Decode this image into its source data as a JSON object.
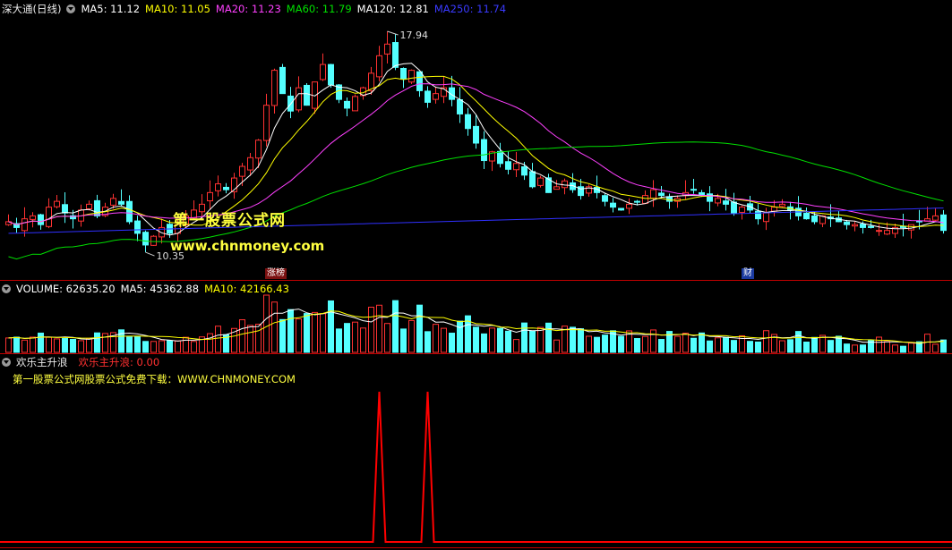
{
  "main_header": {
    "title": "深大通(日线)",
    "ma5": "MA5: 11.12",
    "ma10": "MA10: 11.05",
    "ma20": "MA20: 11.23",
    "ma60": "MA60: 11.79",
    "ma120": "MA120: 12.81",
    "ma250": "MA250: 11.74"
  },
  "volume_header": {
    "volume": "VOLUME: 62635.20",
    "ma5": "MA5: 45362.88",
    "ma10": "MA10: 42166.43"
  },
  "indicator_header": {
    "name": "欢乐主升浪",
    "value": "欢乐主升浪: 0.00",
    "note": "第一股票公式网股票公式免费下载：WWW.CHNMONEY.COM"
  },
  "markers": {
    "high_label": "17.94",
    "low_label": "10.35",
    "event1": "涨榜",
    "event2": "财"
  },
  "watermark": {
    "line1": "第一股票公式网",
    "line2": "www.chnmoney.com"
  },
  "colors": {
    "up": "#ff3232",
    "down": "#54ffff",
    "ma5": "#ffffff",
    "ma10": "#ffff00",
    "ma20": "#ff40ff",
    "ma60": "#00e000",
    "ma120": "#ffffff",
    "ma250": "#3030ff",
    "separator": "#c00000",
    "indicator": "#ff0000"
  },
  "chart_data": {
    "type": "candlestick",
    "price_close": [
      11.4,
      11.2,
      11.5,
      11.6,
      11.3,
      11.9,
      12.1,
      11.7,
      11.5,
      11.8,
      12.0,
      11.6,
      11.9,
      12.2,
      12.0,
      11.4,
      11.0,
      10.6,
      10.9,
      11.2,
      11.0,
      11.3,
      11.6,
      11.8,
      12.0,
      12.4,
      12.7,
      12.5,
      12.9,
      13.3,
      13.6,
      14.2,
      15.4,
      16.6,
      15.8,
      15.2,
      16.0,
      15.4,
      16.2,
      16.8,
      16.1,
      15.6,
      15.3,
      15.7,
      16.0,
      16.5,
      17.1,
      17.5,
      16.7,
      16.3,
      16.6,
      15.9,
      15.5,
      15.8,
      16.0,
      15.6,
      15.1,
      14.6,
      14.1,
      13.5,
      13.8,
      13.4,
      13.2,
      13.4,
      13.0,
      12.6,
      12.9,
      12.4,
      12.6,
      12.8,
      12.5,
      12.3,
      12.6,
      12.4,
      12.1,
      11.9,
      11.8,
      12.0,
      12.1,
      12.3,
      12.5,
      12.3,
      12.1,
      12.2,
      12.4,
      12.5,
      12.3,
      12.1,
      12.2,
      12.0,
      11.7,
      11.9,
      11.8,
      11.5,
      11.7,
      11.9,
      12.0,
      11.8,
      11.6,
      11.5,
      11.4,
      11.6,
      11.5,
      11.4,
      11.3,
      11.3,
      11.2,
      11.2,
      11.1,
      11.1,
      11.2,
      11.2,
      11.3,
      11.4,
      11.5,
      11.6,
      11.1
    ],
    "volume_ma5": 45362.88,
    "volume_ma10": 42166.43,
    "high": 17.94,
    "low": 10.35,
    "indicator_spikes_at_bar": [
      46,
      52
    ],
    "indicator_value": 0.0
  }
}
